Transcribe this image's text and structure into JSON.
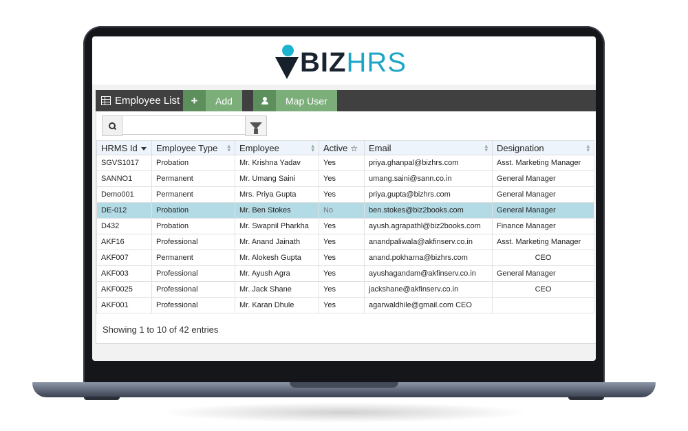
{
  "brand": {
    "logo_biz": "BIZ",
    "logo_hrs": "HRS"
  },
  "toolbar": {
    "title": "Employee List",
    "add_icon": "+",
    "add_label": "Add",
    "map_user_label": "Map User"
  },
  "search": {
    "value": "",
    "placeholder": ""
  },
  "table": {
    "columns": [
      "HRMS Id",
      "Employee Type",
      "Employee",
      "Active",
      "Email",
      "Designation"
    ],
    "rows": [
      {
        "id": "SGVS1017",
        "type": "Probation",
        "name": "Mr. Krishna Yadav",
        "active": "Yes",
        "email": "priya.ghanpal@bizhrs.com",
        "designation": "Asst. Marketing Manager"
      },
      {
        "id": "SANNO1",
        "type": "Permanent",
        "name": "Mr. Umang Saini",
        "active": "Yes",
        "email": "umang.saini@sann.co.in",
        "designation": "General Manager"
      },
      {
        "id": "Demo001",
        "type": "Permanent",
        "name": "Mrs. Priya Gupta",
        "active": "Yes",
        "email": "priya.gupta@bizhrs.com",
        "designation": "General Manager"
      },
      {
        "id": "DE-012",
        "type": "Probation",
        "name": "Mr. Ben Stokes",
        "active": "No",
        "email": "ben.stokes@biz2books.com",
        "designation": "General Manager"
      },
      {
        "id": "D432",
        "type": "Probation",
        "name": "Mr. Swapnil Pharkha",
        "active": "Yes",
        "email": "ayush.agrapathl@biz2books.com",
        "designation": "Finance Manager"
      },
      {
        "id": "AKF16",
        "type": "Professional",
        "name": "Mr. Anand Jainath",
        "active": "Yes",
        "email": "anandpaliwala@akfinserv.co.in",
        "designation": "Asst. Marketing Manager"
      },
      {
        "id": "AKF007",
        "type": "Permanent",
        "name": "Mr. Alokesh Gupta",
        "active": "Yes",
        "email": "anand.pokharna@bizhrs.com",
        "designation": "CEO"
      },
      {
        "id": "AKF003",
        "type": "Professional",
        "name": "Mr. Ayush Agra",
        "active": "Yes",
        "email": "ayushagandam@akfinserv.co.in",
        "designation": "General Manager"
      },
      {
        "id": "AKF0025",
        "type": "Professional",
        "name": "Mr. Jack Shane",
        "active": "Yes",
        "email": "jackshane@akfinserv.co.in",
        "designation": "CEO"
      },
      {
        "id": "AKF001",
        "type": "Professional",
        "name": "Mr. Karan Dhule",
        "active": "Yes",
        "email": "agarwaldhile@gmail.com CEO",
        "designation": ""
      }
    ],
    "selected_row_index": 3
  },
  "footer": {
    "info": "Showing 1 to 10 of 42 entries"
  },
  "colors": {
    "selected_row": "#b3dbe6",
    "toolbar_bg": "#404040",
    "button_green": "#7cae7a",
    "brand_teal": "#1ea5c6"
  },
  "icons": [
    "grid-icon",
    "plus-icon",
    "user-icon",
    "search-icon",
    "filter-icon",
    "sort-icon"
  ]
}
